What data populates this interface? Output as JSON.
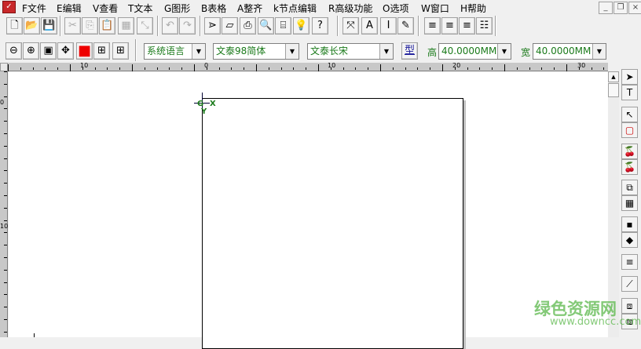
{
  "menu": [
    "F文件",
    "E编辑",
    "V查看",
    "T文本",
    "G图形",
    "B表格",
    "A整齐",
    "k节点编辑",
    "R高级功能",
    "O选项",
    "W窗口",
    "H帮助"
  ],
  "window_controls": {
    "minimize": "_",
    "restore": "❐",
    "close": "×"
  },
  "toolbar1": [
    {
      "icon": "new-icon",
      "glyph": "🗋"
    },
    {
      "icon": "open-icon",
      "glyph": "📂"
    },
    {
      "icon": "save-icon",
      "glyph": "💾"
    },
    {
      "icon": "cut-icon",
      "glyph": "✂",
      "disabled": true
    },
    {
      "icon": "copy-icon",
      "glyph": "⎘",
      "disabled": true
    },
    {
      "icon": "paste-icon",
      "glyph": "📋"
    },
    {
      "icon": "group-icon",
      "glyph": "▦",
      "disabled": true
    },
    {
      "icon": "ungroup-icon",
      "glyph": "⤡",
      "disabled": true
    },
    {
      "icon": "undo-icon",
      "glyph": "↶",
      "disabled": true
    },
    {
      "icon": "redo-icon",
      "glyph": "↷",
      "disabled": true
    },
    {
      "icon": "send-icon",
      "glyph": "⋗"
    },
    {
      "icon": "parallelogram-icon",
      "glyph": "▱"
    },
    {
      "icon": "print-icon",
      "glyph": "⎙"
    },
    {
      "icon": "preview-icon",
      "glyph": "🔍"
    },
    {
      "icon": "frame-icon",
      "glyph": "⌸"
    },
    {
      "icon": "tip-icon",
      "glyph": "💡"
    },
    {
      "icon": "help-icon",
      "glyph": "?"
    },
    {
      "icon": "text-spacing-icon",
      "glyph": "⤧"
    },
    {
      "icon": "text-box-icon",
      "glyph": "A"
    },
    {
      "icon": "italic-icon",
      "glyph": "I"
    },
    {
      "icon": "edit-text-icon",
      "glyph": "✎"
    },
    {
      "icon": "align-left-icon",
      "glyph": "≡"
    },
    {
      "icon": "align-center-icon",
      "glyph": "≡"
    },
    {
      "icon": "align-right-icon",
      "glyph": "≡"
    },
    {
      "icon": "justify-icon",
      "glyph": "☷"
    }
  ],
  "toolbar2": [
    {
      "icon": "zoom-out-icon",
      "glyph": "⊖"
    },
    {
      "icon": "zoom-in-icon",
      "glyph": "⊕"
    },
    {
      "icon": "zoom-fit-icon",
      "glyph": "▣"
    },
    {
      "icon": "pan-icon",
      "glyph": "✥"
    },
    {
      "icon": "color-icon",
      "glyph": "■",
      "color": "#ee0000"
    },
    {
      "icon": "zoom-page-icon",
      "glyph": "⊞"
    },
    {
      "icon": "zoom-all-icon",
      "glyph": "⊞"
    }
  ],
  "font_lang": "系统语言",
  "font_name": "文泰98简体",
  "font_style": "文泰长宋",
  "type_button": "型",
  "height_label": "高",
  "height_value": "40.0000MM",
  "width_label": "宽",
  "width_value": "40.0000MM",
  "ruler_h": [
    "10",
    "0",
    "10",
    "20",
    "30"
  ],
  "ruler_v": [
    "0",
    "10"
  ],
  "origin": {
    "g": "G",
    "x": "X",
    "y": "Y"
  },
  "toolbox": [
    {
      "icon": "select-arrow-icon",
      "glyph": "➤"
    },
    {
      "icon": "text-tool-icon",
      "glyph": "T"
    },
    {
      "icon": "node-edit-icon",
      "glyph": "↖"
    },
    {
      "icon": "rect-tool-icon",
      "glyph": "▢"
    },
    {
      "icon": "cherry-icon",
      "glyph": "🍒"
    },
    {
      "icon": "cherry2-icon",
      "glyph": "🍒"
    },
    {
      "icon": "shape-tool-icon",
      "glyph": "⧉"
    },
    {
      "icon": "table-tool-icon",
      "glyph": "▦"
    },
    {
      "icon": "palette-icon",
      "glyph": "▪"
    },
    {
      "icon": "fill-icon",
      "glyph": "◆"
    },
    {
      "icon": "lines-icon",
      "glyph": "≡"
    },
    {
      "icon": "knife-icon",
      "glyph": "⟋"
    },
    {
      "icon": "tool-a-icon",
      "glyph": "⧈"
    },
    {
      "icon": "tool-b-icon",
      "glyph": "⧈"
    }
  ],
  "watermark": {
    "title": "绿色资源网",
    "url": "www.downcc.com"
  },
  "colors": {
    "label_green": "#1a7a1a",
    "accent_red": "#ee0000"
  }
}
